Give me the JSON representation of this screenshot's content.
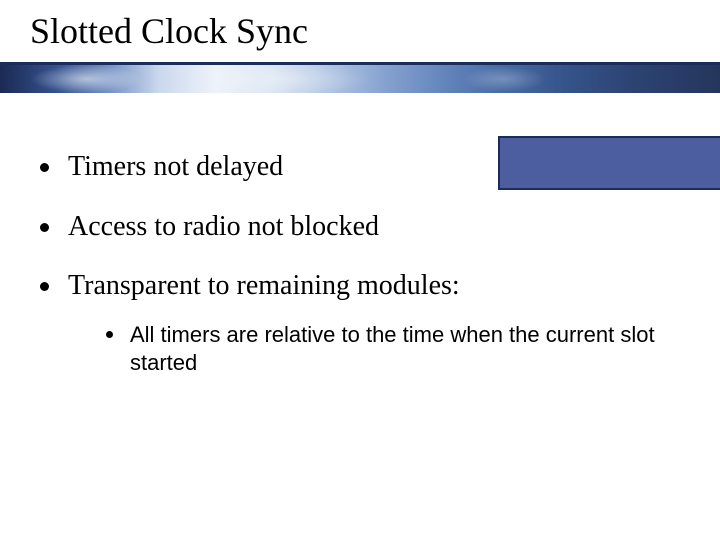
{
  "title": "Slotted Clock Sync",
  "bullets": {
    "b1": "Timers not delayed",
    "b2": "Access to radio not blocked",
    "b3": "Transparent to remaining modules:",
    "sub1": "All timers are relative to the time when the current slot started"
  },
  "colors": {
    "accent": "#1b2b5a",
    "box_fill": "#4c5ea0"
  }
}
